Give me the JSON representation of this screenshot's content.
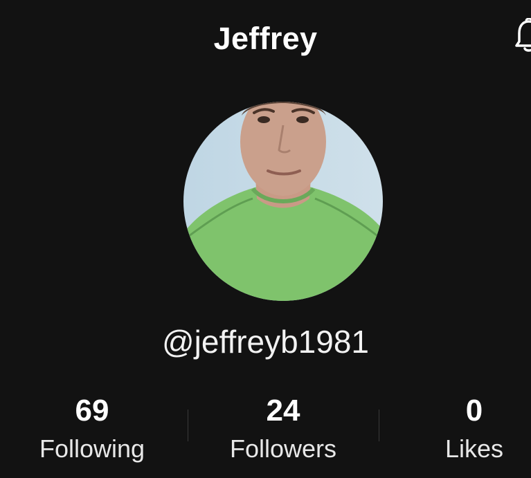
{
  "header": {
    "title": "Jeffrey",
    "notification_icon": "bell-icon"
  },
  "profile": {
    "avatar_icon": "profile-photo",
    "handle": "@jeffreyb1981"
  },
  "stats": [
    {
      "value": "69",
      "label": "Following"
    },
    {
      "value": "24",
      "label": "Followers"
    },
    {
      "value": "0",
      "label": "Likes"
    }
  ],
  "colors": {
    "background": "#121212",
    "text": "#ffffff",
    "divider": "#3a3a3a"
  }
}
